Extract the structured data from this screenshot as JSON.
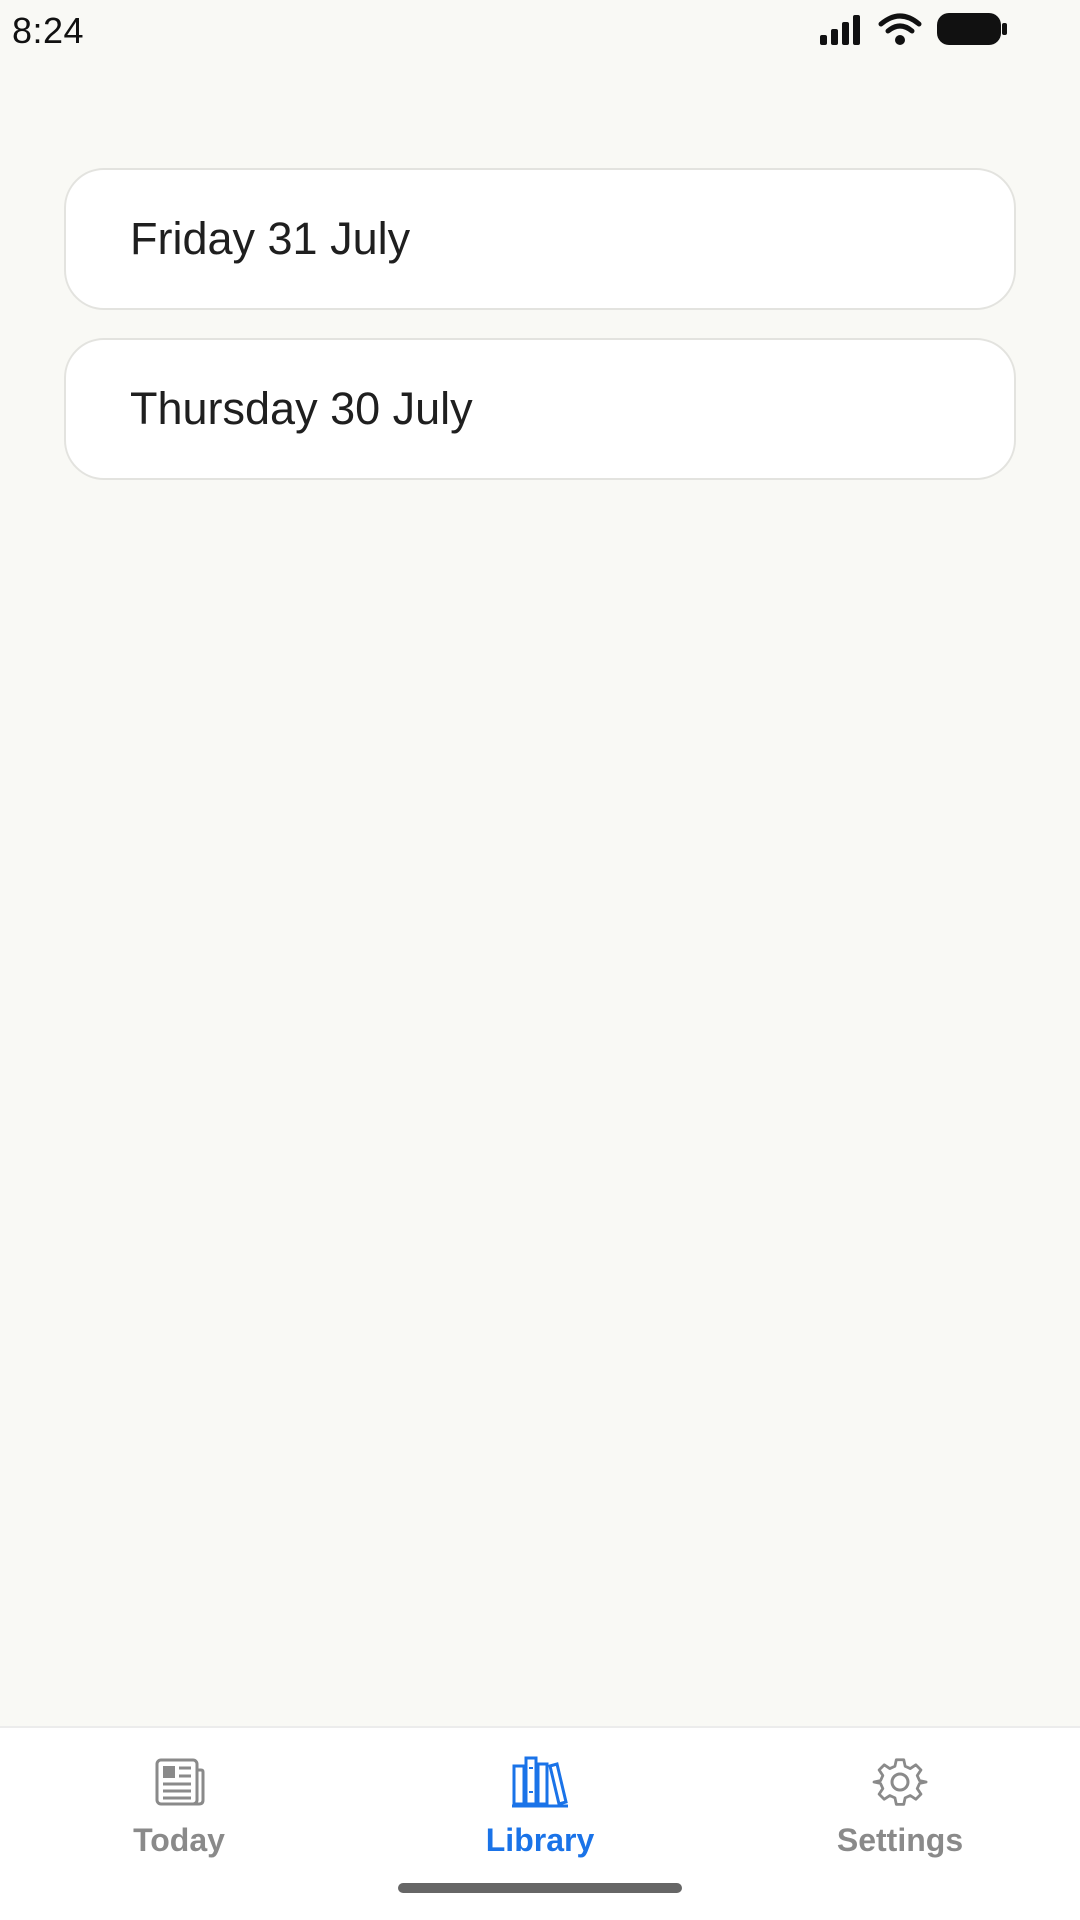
{
  "status_bar": {
    "time": "8:24",
    "icons": [
      "cellular-signal-icon",
      "wifi-icon",
      "battery-icon"
    ]
  },
  "days": [
    {
      "label": "Friday 31 July"
    },
    {
      "label": "Thursday 30 July"
    }
  ],
  "tab_bar": {
    "accent_color": "#1a73e8",
    "inactive_color": "#8a8a8a",
    "active_tab": "Library",
    "tabs": [
      {
        "label": "Today",
        "icon": "newspaper-icon"
      },
      {
        "label": "Library",
        "icon": "books-icon"
      },
      {
        "label": "Settings",
        "icon": "gear-icon"
      }
    ]
  }
}
